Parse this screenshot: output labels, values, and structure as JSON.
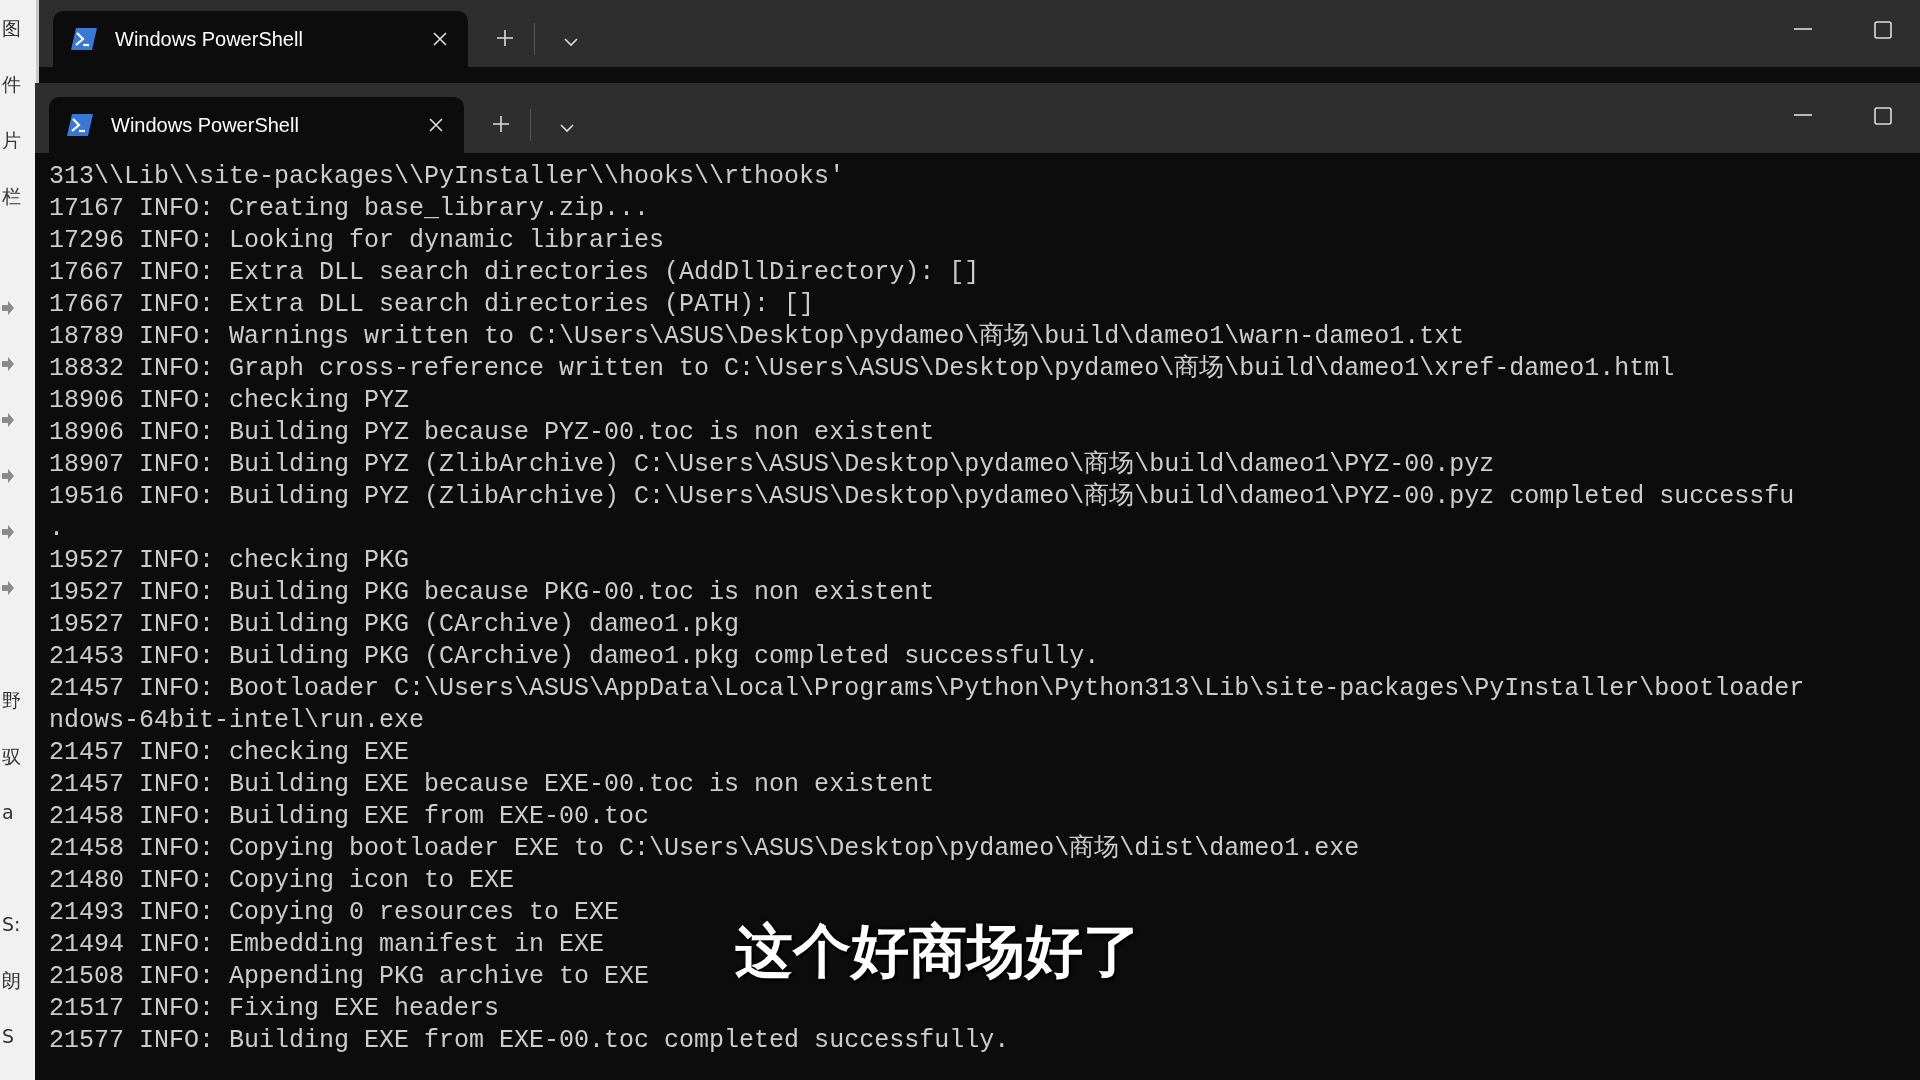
{
  "side_strip": {
    "groups": [
      [
        {
          "kind": "text",
          "text": "图"
        },
        {
          "kind": "text",
          "text": "件"
        },
        {
          "kind": "text",
          "text": "片"
        },
        {
          "kind": "text",
          "text": "栏"
        }
      ],
      [
        {
          "kind": "icon"
        },
        {
          "kind": "icon"
        },
        {
          "kind": "icon"
        },
        {
          "kind": "icon"
        },
        {
          "kind": "icon"
        },
        {
          "kind": "icon"
        }
      ],
      [
        {
          "kind": "text",
          "text": "野"
        },
        {
          "kind": "text",
          "text": "驭"
        },
        {
          "kind": "text",
          "text": "a"
        }
      ],
      [
        {
          "kind": "text",
          "text": "S:"
        },
        {
          "kind": "text",
          "text": "朗"
        },
        {
          "kind": "text",
          "text": "S"
        }
      ]
    ]
  },
  "windows": [
    {
      "tabs": [
        {
          "title": "Windows PowerShell",
          "selected": true
        }
      ]
    },
    {
      "tabs": [
        {
          "title": "Windows PowerShell",
          "selected": true
        }
      ],
      "terminal": {
        "lines": [
          "313\\\\Lib\\\\site-packages\\\\PyInstaller\\\\hooks\\\\rthooks'",
          "17167 INFO: Creating base_library.zip...",
          "17296 INFO: Looking for dynamic libraries",
          "17667 INFO: Extra DLL search directories (AddDllDirectory): []",
          "17667 INFO: Extra DLL search directories (PATH): []",
          "18789 INFO: Warnings written to C:\\Users\\ASUS\\Desktop\\pydameo\\商场\\build\\dameo1\\warn-dameo1.txt",
          "18832 INFO: Graph cross-reference written to C:\\Users\\ASUS\\Desktop\\pydameo\\商场\\build\\dameo1\\xref-dameo1.html",
          "18906 INFO: checking PYZ",
          "18906 INFO: Building PYZ because PYZ-00.toc is non existent",
          "18907 INFO: Building PYZ (ZlibArchive) C:\\Users\\ASUS\\Desktop\\pydameo\\商场\\build\\dameo1\\PYZ-00.pyz",
          "19516 INFO: Building PYZ (ZlibArchive) C:\\Users\\ASUS\\Desktop\\pydameo\\商场\\build\\dameo1\\PYZ-00.pyz completed successfu",
          ".",
          "19527 INFO: checking PKG",
          "19527 INFO: Building PKG because PKG-00.toc is non existent",
          "19527 INFO: Building PKG (CArchive) dameo1.pkg",
          "21453 INFO: Building PKG (CArchive) dameo1.pkg completed successfully.",
          "21457 INFO: Bootloader C:\\Users\\ASUS\\AppData\\Local\\Programs\\Python\\Python313\\Lib\\site-packages\\PyInstaller\\bootloader",
          "ndows-64bit-intel\\run.exe",
          "21457 INFO: checking EXE",
          "21457 INFO: Building EXE because EXE-00.toc is non existent",
          "21458 INFO: Building EXE from EXE-00.toc",
          "21458 INFO: Copying bootloader EXE to C:\\Users\\ASUS\\Desktop\\pydameo\\商场\\dist\\dameo1.exe",
          "21480 INFO: Copying icon to EXE",
          "21493 INFO: Copying 0 resources to EXE",
          "21494 INFO: Embedding manifest in EXE",
          "21508 INFO: Appending PKG archive to EXE",
          "21517 INFO: Fixing EXE headers",
          "21577 INFO: Building EXE from EXE-00.toc completed successfully."
        ]
      },
      "subtitle": "这个好商场好了"
    }
  ]
}
